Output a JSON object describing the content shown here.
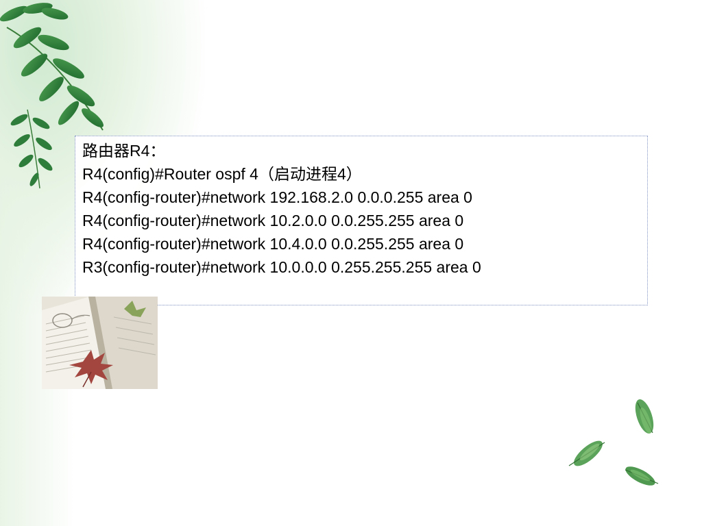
{
  "content": {
    "lines": [
      "路由器R4：",
      "R4(config)#Router ospf 4（启动进程4）",
      "R4(config-router)#network 192.168.2.0 0.0.0.255 area 0",
      "R4(config-router)#network 10.2.0.0 0.0.255.255 area 0",
      "R4(config-router)#network 10.4.0.0 0.0.255.255 area 0",
      "R3(config-router)#network 10.0.0.0 0.255.255.255 area 0"
    ]
  },
  "decorations": {
    "top_left": "fern-leaves-icon",
    "photo": "open-book-with-maple-leaf-image",
    "bottom_right": "falling-leaves-icon"
  },
  "colors": {
    "text": "#000000",
    "box_border": "#7e8fc2",
    "leaf_dark": "#2f7d3a",
    "leaf_light": "#7cc06b"
  }
}
